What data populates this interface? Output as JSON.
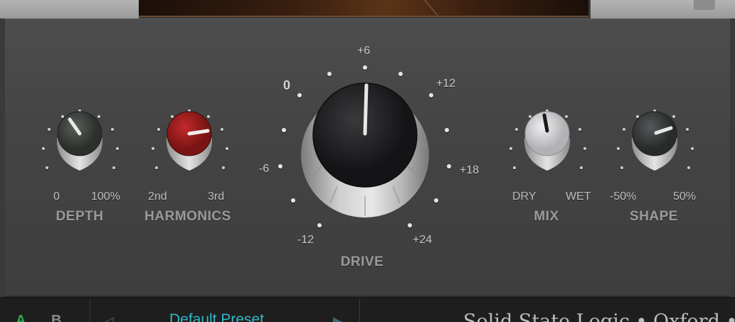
{
  "controls": {
    "depth": {
      "title": "DEPTH",
      "min_label": "0",
      "max_label": "100%"
    },
    "harmonics": {
      "title": "HARMONICS",
      "min_label": "2nd",
      "max_label": "3rd"
    },
    "drive": {
      "title": "DRIVE",
      "scale": {
        "m12": "-12",
        "m6": "-6",
        "z": "0",
        "p6": "+6",
        "p12": "+12",
        "p18": "+18",
        "p24": "+24"
      }
    },
    "mix": {
      "title": "MIX",
      "min_label": "DRY",
      "max_label": "WET"
    },
    "shape": {
      "title": "SHAPE",
      "min_label": "-50%",
      "max_label": "50%"
    }
  },
  "knob_colors": {
    "depth": "#3c403c",
    "harmonics": "#a01e1e",
    "drive": "#1f1f21",
    "mix": "#d4d4d6",
    "shape": "#363a36"
  },
  "footer": {
    "ab_a": "A",
    "ab_b": "B",
    "preset_prev": "◁",
    "preset_name": "Default Preset",
    "preset_next": "▶",
    "brand": "Solid State Logic • Oxford • En"
  }
}
